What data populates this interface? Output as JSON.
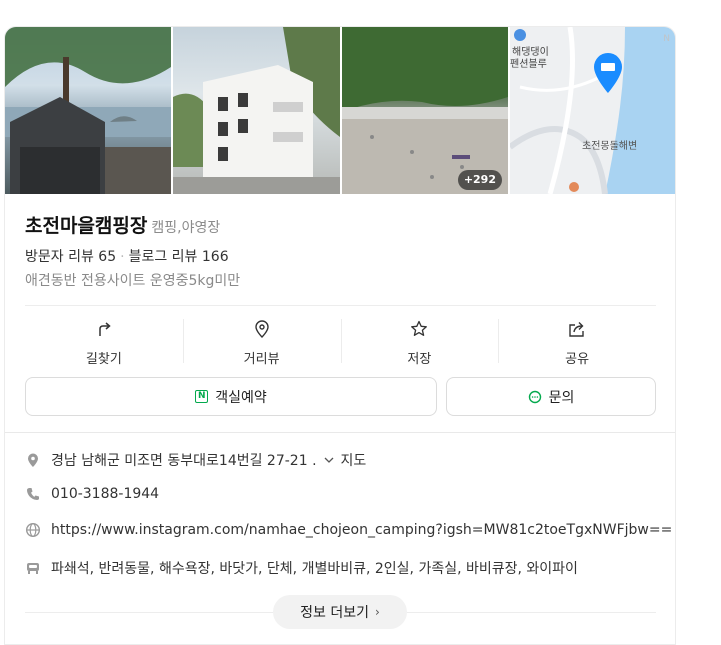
{
  "photos": {
    "more_count": "+292",
    "map_labels": {
      "label1": "해댕댕이",
      "label2": "펜션블루",
      "label3": "초전몽돌해변"
    },
    "colors": {
      "pin": "#1a8cff",
      "sea": "#a9d3f2"
    }
  },
  "place": {
    "name": "초전마을캠핑장",
    "category": "캠핑,야영장",
    "visitor_reviews": "방문자 리뷰 65",
    "blog_reviews": "블로그 리뷰 166",
    "description": "애견동반 전용사이트 운영중5kg미만"
  },
  "actions": [
    {
      "label": "길찾기",
      "icon": "directions-icon"
    },
    {
      "label": "거리뷰",
      "icon": "location-pin-icon"
    },
    {
      "label": "저장",
      "icon": "star-icon"
    },
    {
      "label": "공유",
      "icon": "share-icon"
    }
  ],
  "buttons": {
    "booking": "객실예약",
    "inquiry": "문의"
  },
  "info": {
    "address": "경남 남해군 미조면 동부대로14번길 27-21 .",
    "map_link": "지도",
    "phone": "010-3188-1944",
    "website": "https://www.instagram.com/namhae_chojeon_camping?igsh=MW81c2toeTgxNWFjbw==",
    "amenities": "파쇄석, 반려동물, 해수욕장, 바닷가, 단체, 개별바비큐, 2인실, 가족실, 바비큐장, 와이파이"
  },
  "more_info": "정보 더보기"
}
